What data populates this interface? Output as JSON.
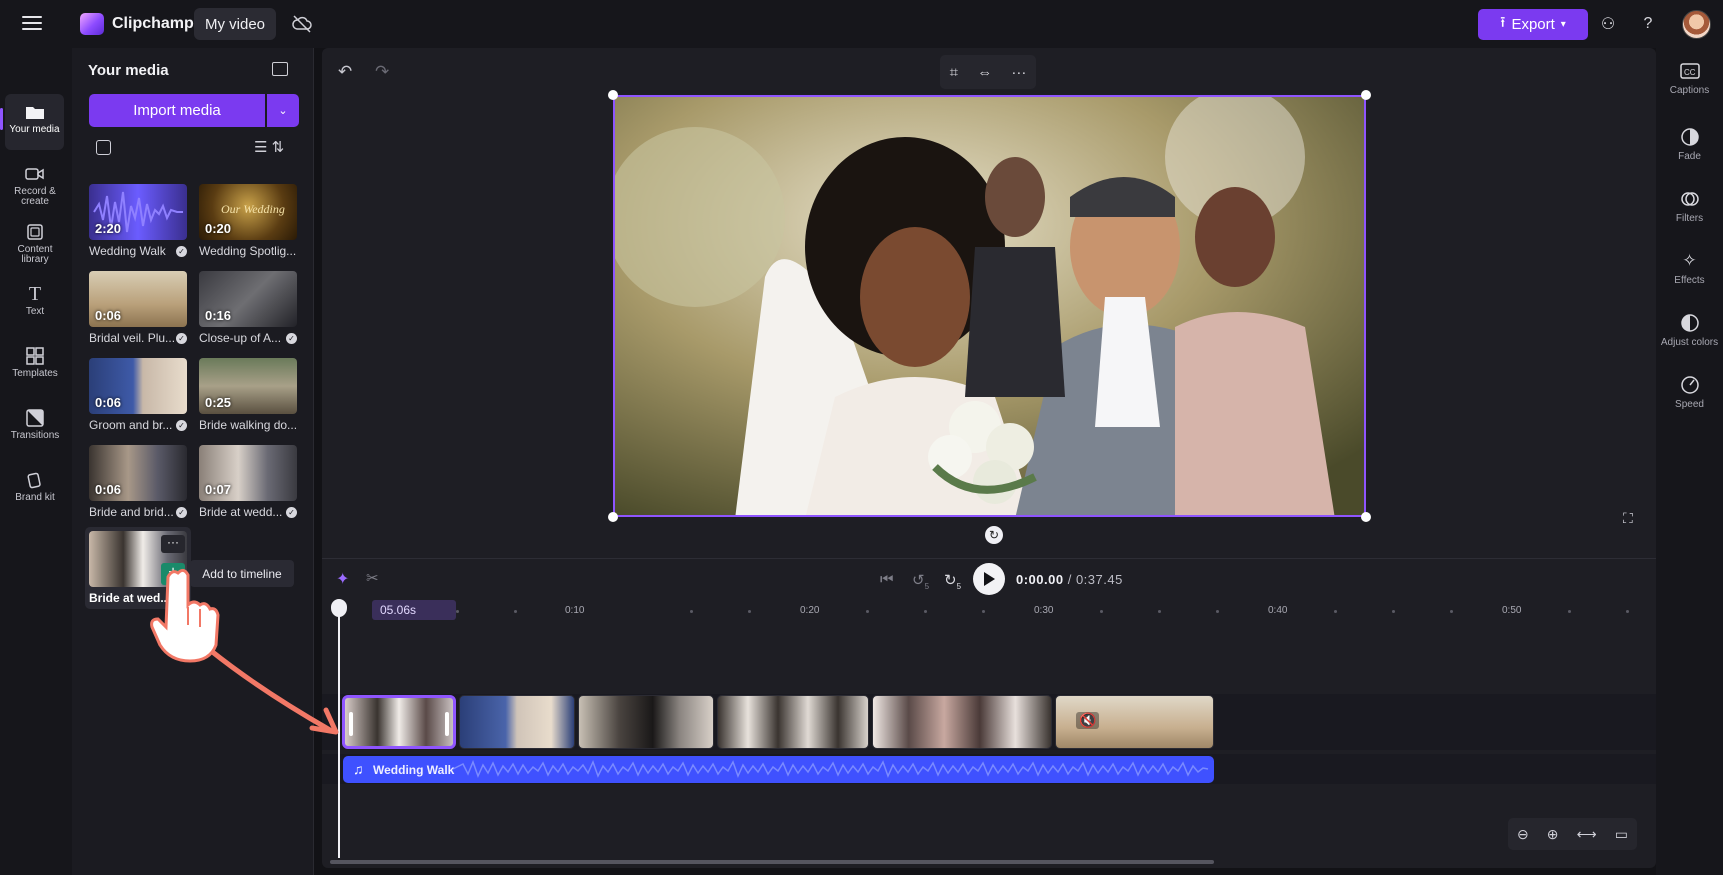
{
  "app": {
    "name": "Clipchamp",
    "project_title": "My video",
    "export_label": "Export"
  },
  "left_nav": [
    {
      "label": "Your media",
      "icon": "folder-icon"
    },
    {
      "label": "Record & create",
      "icon": "camera-icon"
    },
    {
      "label": "Content library",
      "icon": "library-icon"
    },
    {
      "label": "Text",
      "icon": "text-icon"
    },
    {
      "label": "Templates",
      "icon": "templates-icon"
    },
    {
      "label": "Transitions",
      "icon": "transitions-icon"
    },
    {
      "label": "Brand kit",
      "icon": "brand-kit-icon"
    }
  ],
  "media_panel": {
    "title": "Your media",
    "import_label": "Import media",
    "tooltip": "Add to timeline",
    "items": [
      {
        "duration": "2:20",
        "label": "Wedding Walk"
      },
      {
        "duration": "0:20",
        "label": "Wedding Spotlig..."
      },
      {
        "duration": "0:06",
        "label": "Bridal veil. Plu..."
      },
      {
        "duration": "0:16",
        "label": "Close-up of A..."
      },
      {
        "duration": "0:06",
        "label": "Groom and br..."
      },
      {
        "duration": "0:25",
        "label": "Bride walking do..."
      },
      {
        "duration": "0:06",
        "label": "Bride and brid..."
      },
      {
        "duration": "0:07",
        "label": "Bride at wedd..."
      },
      {
        "duration": "",
        "label": "Bride at wed..."
      }
    ]
  },
  "player": {
    "current_time": "0:00.00",
    "total_time": "/ 0:37.45",
    "skip_back": "5",
    "skip_forward": "5"
  },
  "timeline": {
    "playhead_badge": "05.06s",
    "ruler_labels": [
      "0:10",
      "0:20",
      "0:30",
      "0:40",
      "0:50"
    ],
    "audio_track_label": "Wedding Walk"
  },
  "right_nav": [
    {
      "label": "Captions",
      "icon": "captions-icon"
    },
    {
      "label": "Fade",
      "icon": "fade-icon"
    },
    {
      "label": "Filters",
      "icon": "filters-icon"
    },
    {
      "label": "Effects",
      "icon": "effects-icon"
    },
    {
      "label": "Adjust colors",
      "icon": "adjust-colors-icon"
    },
    {
      "label": "Speed",
      "icon": "speed-icon"
    }
  ],
  "colors": {
    "accent": "#7b3af0",
    "selection": "#8f55ff",
    "audio": "#3f51ff",
    "background": "#121216"
  }
}
